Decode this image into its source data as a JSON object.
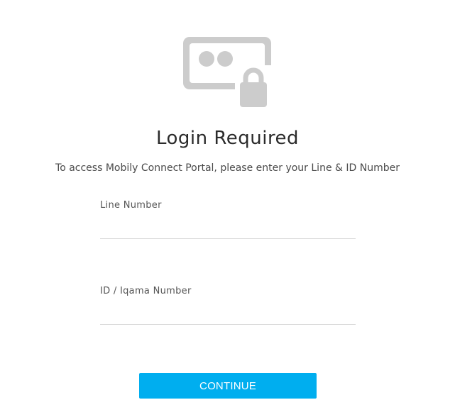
{
  "header": {
    "icon": "id-card-lock-icon",
    "title": "Login Required",
    "subtitle": "To access Mobily Connect Portal, please enter your Line & ID Number"
  },
  "form": {
    "line_number": {
      "label": "Line Number",
      "value": "",
      "placeholder": ""
    },
    "id_number": {
      "label": "ID / Iqama Number",
      "value": "",
      "placeholder": ""
    },
    "continue_label": "CONTINUE"
  },
  "colors": {
    "accent": "#00aeef",
    "icon_gray": "#cccccc",
    "title_text": "#2b2b2b",
    "divider": "#d9d9d9"
  }
}
